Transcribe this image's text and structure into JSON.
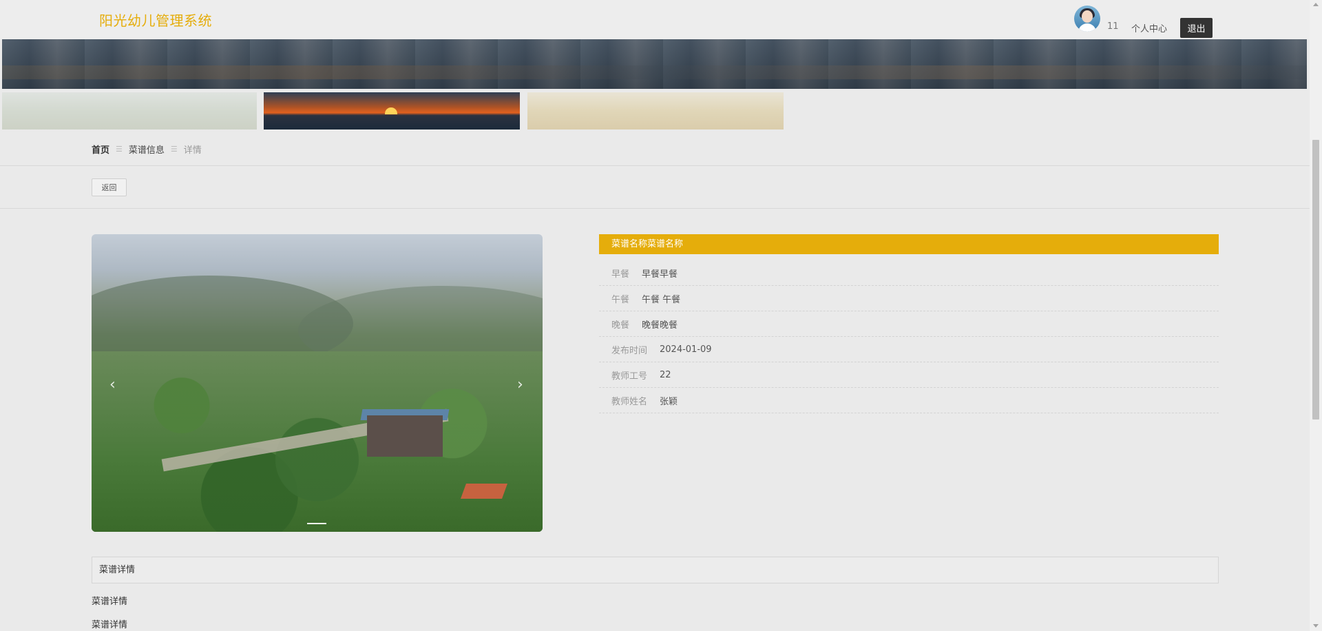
{
  "header": {
    "brand": "阳光幼儿管理系统",
    "user_count": "11",
    "profile_link": "个人中心",
    "logout_label": "退出"
  },
  "breadcrumb": {
    "home": "首页",
    "list": "菜谱信息",
    "current": "详情",
    "separator": "☰"
  },
  "toolbar": {
    "back_label": "返回"
  },
  "carousel": {
    "prev_symbol": "‹",
    "next_symbol": "›"
  },
  "detail": {
    "title": "菜谱名称菜谱名称",
    "rows": [
      {
        "label": "早餐",
        "value": "早餐早餐"
      },
      {
        "label": "午餐",
        "value": "午餐 午餐"
      },
      {
        "label": "晚餐",
        "value": "晚餐晚餐"
      },
      {
        "label": "发布时间",
        "value": "2024-01-09"
      },
      {
        "label": "教师工号",
        "value": "22"
      },
      {
        "label": "教师姓名",
        "value": "张颖"
      }
    ]
  },
  "description": {
    "header": "菜谱详情",
    "lines": [
      "菜谱详情",
      "菜谱详情"
    ]
  },
  "colors": {
    "accent": "#e5ad0b",
    "logout_bg": "#333333",
    "page_bg": "#eaeaea"
  },
  "icons": {
    "avatar": "user-avatar-icon",
    "prev": "chevron-left-icon",
    "next": "chevron-right-icon"
  }
}
